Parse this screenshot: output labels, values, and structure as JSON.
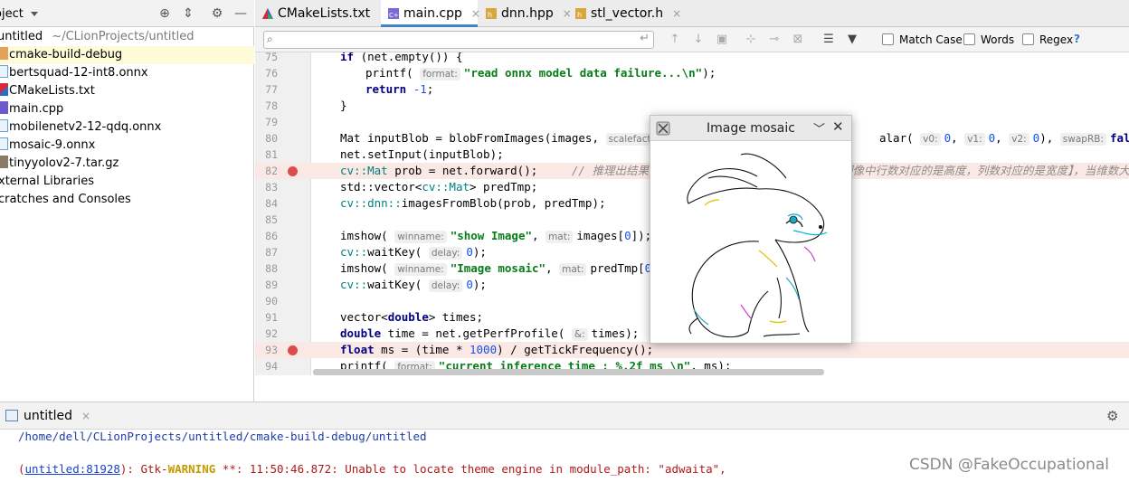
{
  "project": {
    "title": "oject",
    "tree": [
      {
        "name": "untitled",
        "path": "~/CLionProjects/untitled",
        "type": "root"
      },
      {
        "name": "cmake-build-debug",
        "type": "folder",
        "selected": true
      },
      {
        "name": "bertsquad-12-int8.onnx",
        "type": "onnx"
      },
      {
        "name": "CMakeLists.txt",
        "type": "cmake"
      },
      {
        "name": "main.cpp",
        "type": "cpp"
      },
      {
        "name": "mobilenetv2-12-qdq.onnx",
        "type": "onnx"
      },
      {
        "name": "mosaic-9.onnx",
        "type": "onnx"
      },
      {
        "name": "tinyyolov2-7.tar.gz",
        "type": "gz"
      },
      {
        "name": "xternal Libraries",
        "type": "lib"
      },
      {
        "name": "cratches and Consoles",
        "type": "scratch"
      }
    ]
  },
  "tabs": [
    {
      "label": "CMakeLists.txt",
      "close": "×"
    },
    {
      "label": "main.cpp",
      "close": "×",
      "active": true
    },
    {
      "label": "dnn.hpp",
      "close": "×"
    },
    {
      "label": "stl_vector.h",
      "close": "×"
    }
  ],
  "find_bar": {
    "search_value": "",
    "match_case": "Match Case",
    "words": "Words",
    "regex": "Regex",
    "help": "?"
  },
  "editor": {
    "lines": [
      {
        "n": "75"
      },
      {
        "n": "76"
      },
      {
        "n": "77"
      },
      {
        "n": "78"
      },
      {
        "n": "79"
      },
      {
        "n": "80"
      },
      {
        "n": "81"
      },
      {
        "n": "82",
        "breakpoint": true
      },
      {
        "n": "83"
      },
      {
        "n": "84"
      },
      {
        "n": "85"
      },
      {
        "n": "86"
      },
      {
        "n": "87"
      },
      {
        "n": "88"
      },
      {
        "n": "89"
      },
      {
        "n": "90"
      },
      {
        "n": "91"
      },
      {
        "n": "92"
      },
      {
        "n": "93",
        "breakpoint": true
      },
      {
        "n": "94"
      }
    ],
    "code": {
      "l75_kw": "if",
      "l75_rest": " (net.empty()) {",
      "l76_fn": "printf(",
      "l76_hint": "format:",
      "l76_str": "\"read onnx model data failure...\\n\"",
      "l76_end": ");",
      "l77_kw": "return",
      "l77_num": "-1",
      "l77_end": ";",
      "l78": "}",
      "l80_a": "Mat inputBlob = blobFromImages(images,",
      "l80_hint1": "scalefactor:",
      "l80_b": "alar(",
      "l80_hv0": "v0:",
      "l80_v0": "0",
      "l80_hv1": "v1:",
      "l80_v1": "0",
      "l80_hv2": "v2:",
      "l80_v2": "0",
      "l80_c": "),",
      "l80_hswap": "swapRB:",
      "l80_false": "false",
      "l80_d": ",",
      "l81": "net.setInput(inputBlob);",
      "l82_ns": "cv::",
      "l82_type": "Mat",
      "l82_rest": " prob = net.forward();",
      "l82_cmt": "// 推理出结果  c",
      "l82_cmt2": "图像中行数对应的是高度，列数对应的是宽度】，当维数大",
      "l83_a": "std::vector<",
      "l83_ns": "cv::",
      "l83_type": "Mat",
      "l83_b": "> predTmp;",
      "l84_ns": "cv::dnn::",
      "l84_rest": "imagesFromBlob(prob, predTmp);",
      "l86_fn": "imshow(",
      "l86_h1": "winname:",
      "l86_str": "\"show Image\"",
      "l86_c": ",",
      "l86_h2": "mat:",
      "l86_rest": "images[",
      "l86_num": "0",
      "l86_end": "]);",
      "l87_ns": "cv::",
      "l87_fn": "waitKey(",
      "l87_h": "delay:",
      "l87_num": "0",
      "l87_end": ");",
      "l88_fn": "imshow(",
      "l88_h1": "winname:",
      "l88_str": "\"Image mosaic\"",
      "l88_c": ",",
      "l88_h2": "mat:",
      "l88_rest": "predTmp[",
      "l88_num": "0",
      "l88_end": "])",
      "l89_ns": "cv::",
      "l89_fn": "waitKey(",
      "l89_h": "delay:",
      "l89_num": "0",
      "l89_end": ");",
      "l91_a": "vector<",
      "l91_kw": "double",
      "l91_b": "> times;",
      "l92_kw": "double",
      "l92_a": " time = net.getPerfProfile(",
      "l92_h": "&:",
      "l92_b": "times);",
      "l93_kw": "float",
      "l93_a": " ms = (time * ",
      "l93_num": "1000",
      "l93_b": ") / getTickFrequency();",
      "l94_fn": "printf(",
      "l94_hint": "format:",
      "l94_str": "\"current inference time : %.2f ms \\n\"",
      "l94_end": ", ms);"
    }
  },
  "image_window": {
    "title": "Image mosaic",
    "minimize": "﹀",
    "close": "✕"
  },
  "run_panel": {
    "tab_label": "untitled",
    "tab_close": "×",
    "output": {
      "path": "/home/dell/CLionProjects/untitled/cmake-build-debug/untitled",
      "err_open": "(",
      "err_link": "untitled:81928",
      "err_mid": "): Gtk-",
      "err_warn": "WARNING",
      "err_rest": " **: 11:50:46.872: Unable to locate theme engine in module_path: \"adwaita\","
    }
  },
  "watermark": "CSDN @FakeOccupational",
  "colors": {
    "accent": "#4083c9",
    "breakpoint": "#d94d4d",
    "breakpoint_line": "#fae8e4",
    "selected_row": "#fffbd9",
    "keyword": "#000080",
    "string": "#067d17"
  }
}
